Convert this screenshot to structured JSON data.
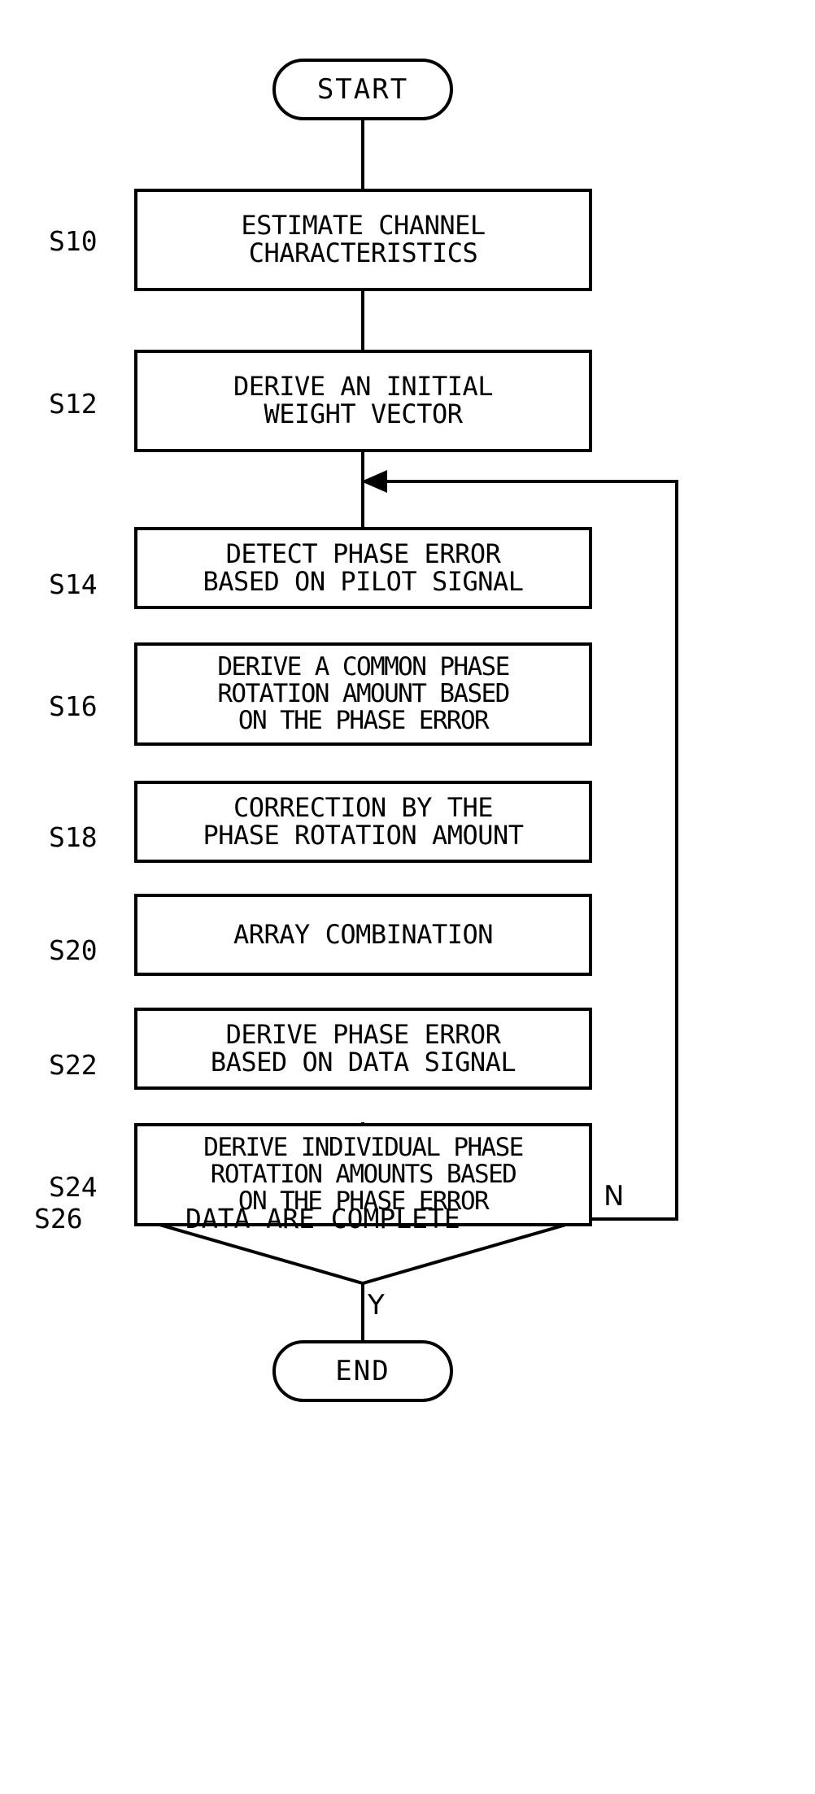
{
  "figure": {
    "type": "flowchart",
    "orientation": "top-to-bottom",
    "background_color": "#ffffff",
    "line_color": "#000000"
  },
  "start": {
    "label": "START"
  },
  "end": {
    "label": "END"
  },
  "steps": [
    {
      "id": "S10",
      "shape": "process",
      "lines": [
        "ESTIMATE CHANNEL",
        "CHARACTERISTICS"
      ],
      "text": "ESTIMATE CHANNEL\nCHARACTERISTICS"
    },
    {
      "id": "S12",
      "shape": "process",
      "lines": [
        "DERIVE AN INITIAL",
        "WEIGHT VECTOR"
      ],
      "text": "DERIVE AN INITIAL\nWEIGHT VECTOR"
    },
    {
      "id": "S14",
      "shape": "process",
      "lines": [
        "DETECT PHASE ERROR",
        "BASED ON PILOT SIGNAL"
      ],
      "text": "DETECT PHASE ERROR\nBASED ON PILOT SIGNAL"
    },
    {
      "id": "S16",
      "shape": "process",
      "lines": [
        "DERIVE A COMMON PHASE",
        "ROTATION AMOUNT BASED",
        "ON THE PHASE ERROR"
      ],
      "text": "DERIVE A COMMON PHASE\nROTATION AMOUNT BASED\nON THE PHASE ERROR"
    },
    {
      "id": "S18",
      "shape": "process",
      "lines": [
        "CORRECTION BY THE",
        "PHASE ROTATION AMOUNT"
      ],
      "text": "CORRECTION BY THE\nPHASE ROTATION AMOUNT"
    },
    {
      "id": "S20",
      "shape": "process",
      "lines": [
        "ARRAY COMBINATION"
      ],
      "text": "ARRAY COMBINATION"
    },
    {
      "id": "S22",
      "shape": "process",
      "lines": [
        "DERIVE PHASE ERROR",
        "BASED ON DATA SIGNAL"
      ],
      "text": "DERIVE PHASE ERROR\nBASED ON DATA SIGNAL"
    },
    {
      "id": "S24",
      "shape": "process",
      "lines": [
        "DERIVE INDIVIDUAL PHASE",
        "ROTATION AMOUNTS BASED",
        "ON THE PHASE ERROR"
      ],
      "text": "DERIVE INDIVIDUAL PHASE\nROTATION AMOUNTS BASED\nON THE PHASE ERROR"
    },
    {
      "id": "S26",
      "shape": "decision",
      "lines": [
        "DATA ARE COMPLETE"
      ],
      "text": "DATA ARE COMPLETE"
    }
  ],
  "decision": {
    "id": "S26",
    "question": "DATA ARE COMPLETE",
    "no_label": "N",
    "yes_label": "Y",
    "no_target": "S14",
    "yes_target": "END"
  }
}
